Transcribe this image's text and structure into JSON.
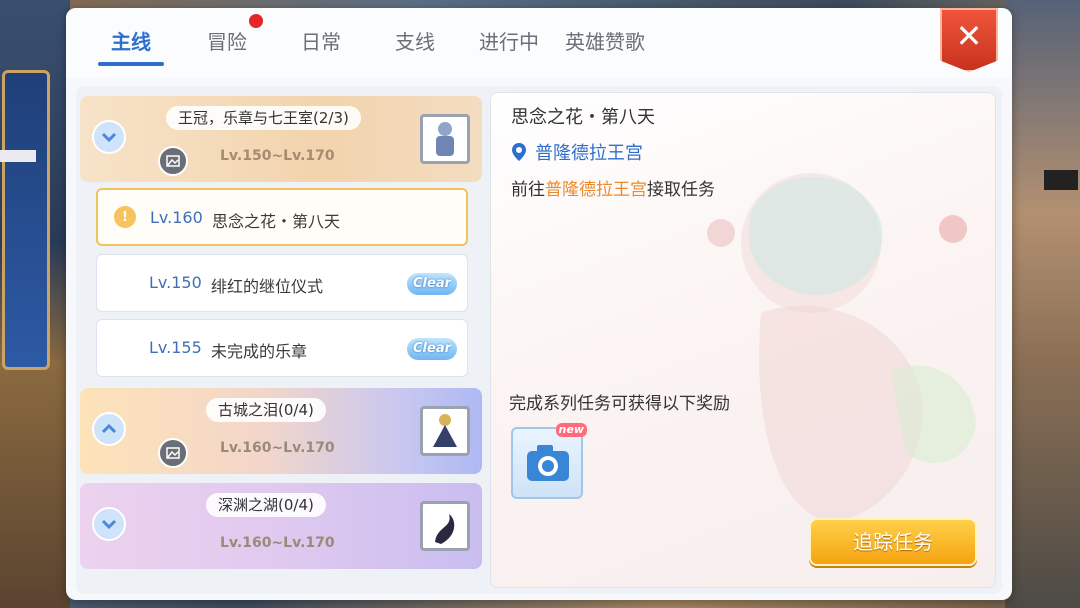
{
  "tabs": [
    {
      "label": "主线",
      "active": true
    },
    {
      "label": "冒险",
      "active": false,
      "has_notification": true
    },
    {
      "label": "日常",
      "active": false
    },
    {
      "label": "支线",
      "active": false
    },
    {
      "label": "进行中",
      "active": false
    },
    {
      "label": "英雄赞歌",
      "active": false
    }
  ],
  "close_label": "✕",
  "chapters": [
    {
      "title": "王冠，乐章与七王室(2/3)",
      "level": "Lv.150~Lv.170",
      "expanded": true
    },
    {
      "title": "古城之泪(0/4)",
      "level": "Lv.160~Lv.170",
      "expanded": false
    },
    {
      "title": "深渊之湖(0/4)",
      "level": "Lv.160~Lv.170",
      "expanded": false
    }
  ],
  "quests": [
    {
      "level": "Lv.160",
      "name": "思念之花・第八天",
      "selected": true,
      "status": "!"
    },
    {
      "level": "Lv.150",
      "name": "绯红的继位仪式",
      "clear": "Clear"
    },
    {
      "level": "Lv.155",
      "name": "未完成的乐章",
      "clear": "Clear"
    }
  ],
  "detail": {
    "title": "思念之花・第八天",
    "location": "普隆德拉王宫",
    "desc_prefix": "前往",
    "desc_highlight": "普隆德拉王宫",
    "desc_suffix": "接取任务",
    "reward_title": "完成系列任务可获得以下奖励",
    "reward_badge": "new",
    "track_button": "追踪任务"
  },
  "colors": {
    "accent": "#2e6fcd",
    "highlight": "#ec8a2a",
    "notification": "#e32525",
    "button": "#f5a411"
  }
}
